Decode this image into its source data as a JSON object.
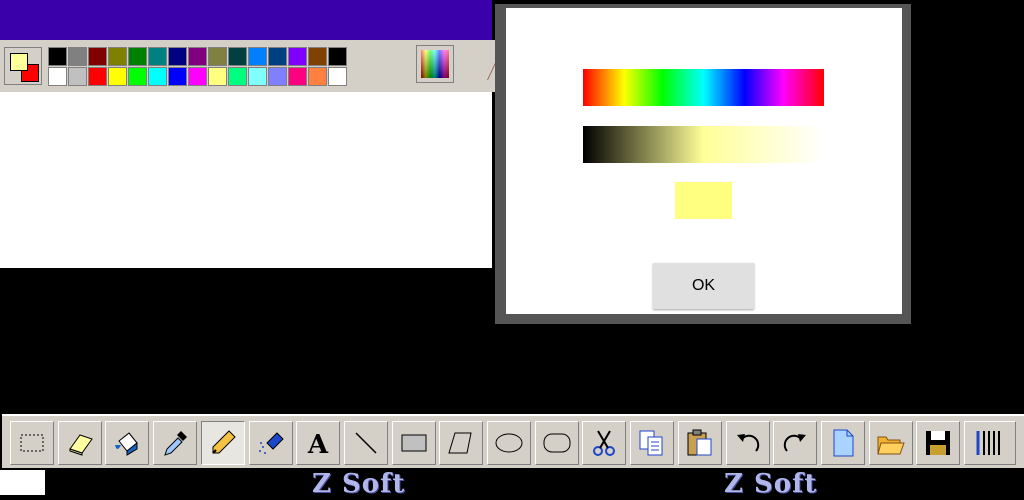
{
  "app": {
    "title_bar_color": "#3a00aa"
  },
  "palette": {
    "foreground_color": "#ffff99",
    "background_color": "#ff0000",
    "top_row": [
      "#000000",
      "#808080",
      "#800000",
      "#808000",
      "#008000",
      "#008080",
      "#000080",
      "#800080",
      "#808040",
      "#004040",
      "#0080ff",
      "#004080",
      "#8000ff",
      "#804000",
      "#000000"
    ],
    "bottom_row": [
      "#ffffff",
      "#c0c0c0",
      "#ff0000",
      "#ffff00",
      "#00ff00",
      "#00ffff",
      "#0000ff",
      "#ff00ff",
      "#ffff80",
      "#00ff80",
      "#80ffff",
      "#8080ff",
      "#ff0080",
      "#ff8040",
      "#ffffff"
    ],
    "custom_colors_icon": "rainbow-gradient-icon"
  },
  "color_dialog": {
    "hue_bar_icon": "hue-spectrum",
    "shade_start": "#000000",
    "shade_mid": "#ffff99",
    "shade_end": "#ffffff",
    "selected_color": "#ffff80",
    "ok_label": "OK"
  },
  "toolbar": {
    "tools": [
      {
        "name": "select-tool",
        "icon": "dashed-rectangle-icon"
      },
      {
        "name": "eraser-tool",
        "icon": "eraser-icon"
      },
      {
        "name": "fill-tool",
        "icon": "paint-bucket-icon"
      },
      {
        "name": "color-picker-tool",
        "icon": "eyedropper-icon"
      },
      {
        "name": "pencil-tool",
        "icon": "pencil-icon",
        "active": true
      },
      {
        "name": "airbrush-tool",
        "icon": "spray-can-icon"
      },
      {
        "name": "text-tool",
        "icon": "letter-a-icon",
        "label": "A"
      },
      {
        "name": "line-tool",
        "icon": "line-icon"
      },
      {
        "name": "rectangle-tool",
        "icon": "rectangle-icon"
      },
      {
        "name": "polygon-tool",
        "icon": "polygon-icon"
      },
      {
        "name": "ellipse-tool",
        "icon": "ellipse-icon"
      },
      {
        "name": "rounded-rect-tool",
        "icon": "rounded-rectangle-icon"
      },
      {
        "name": "cut-button",
        "icon": "scissors-icon"
      },
      {
        "name": "copy-button",
        "icon": "copy-icon"
      },
      {
        "name": "paste-button",
        "icon": "paste-icon"
      },
      {
        "name": "undo-button",
        "icon": "undo-icon"
      },
      {
        "name": "redo-button",
        "icon": "redo-icon"
      },
      {
        "name": "new-file-button",
        "icon": "new-page-icon"
      },
      {
        "name": "open-file-button",
        "icon": "open-folder-icon"
      },
      {
        "name": "save-file-button",
        "icon": "floppy-disk-icon"
      },
      {
        "name": "line-width-button",
        "icon": "line-width-icon"
      }
    ]
  },
  "branding": {
    "left_text": "Z Soft",
    "right_text": "Z Soft"
  }
}
